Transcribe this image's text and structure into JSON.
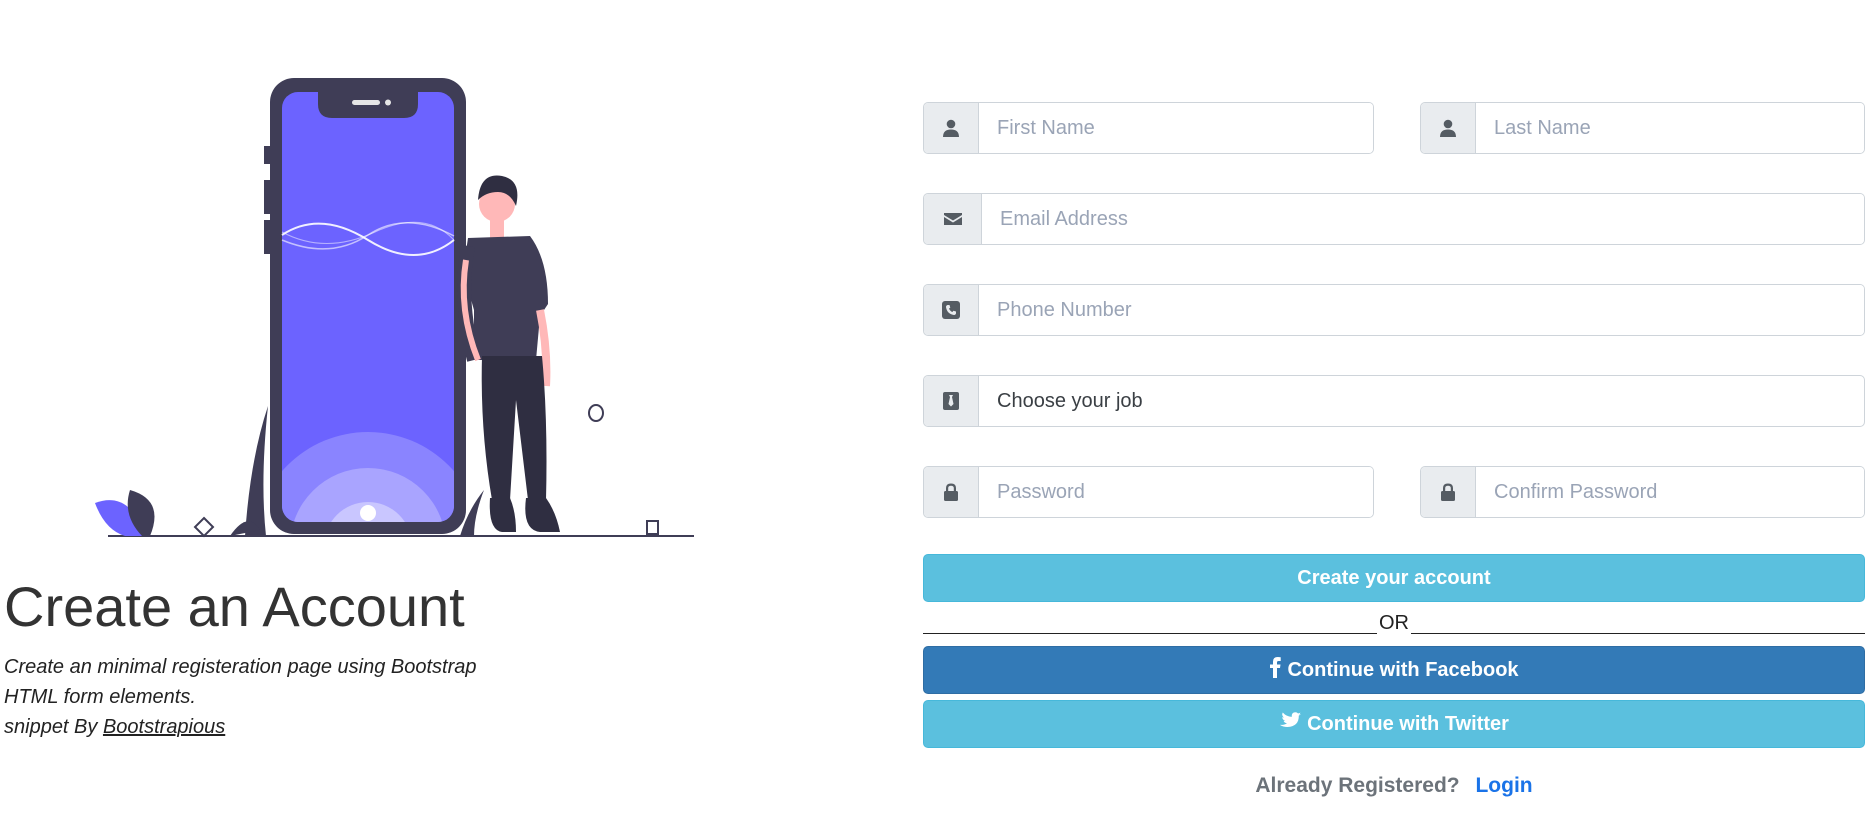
{
  "intro": {
    "heading": "Create an Account",
    "desc_line1": "Create an minimal registeration page using Bootstrap",
    "desc_line2": "HTML form elements.",
    "snippet_prefix": "snippet By",
    "author_link": "Bootstrapious"
  },
  "form": {
    "first_name": {
      "placeholder": "First Name",
      "value": "",
      "icon": "user-icon"
    },
    "last_name": {
      "placeholder": "Last Name",
      "value": "",
      "icon": "user-icon"
    },
    "email": {
      "placeholder": "Email Address",
      "value": "",
      "icon": "envelope-icon"
    },
    "phone": {
      "placeholder": "Phone Number",
      "value": "",
      "icon": "phone-square-icon"
    },
    "job": {
      "selected": "Choose your job",
      "icon": "tie-icon"
    },
    "password": {
      "placeholder": "Password",
      "value": "",
      "icon": "lock-icon"
    },
    "confirm_password": {
      "placeholder": "Confirm Password",
      "value": "",
      "icon": "lock-icon"
    }
  },
  "buttons": {
    "create": "Create your account",
    "or": "OR",
    "facebook": "Continue with Facebook",
    "twitter": "Continue with Twitter"
  },
  "footer": {
    "prompt": "Already Registered?",
    "login": "Login"
  },
  "colors": {
    "create_button": "#5bc0de",
    "facebook_button": "#337ab7",
    "twitter_button": "#5bc0de",
    "phone_screen": "#6c63ff",
    "link": "#1a73e8"
  }
}
